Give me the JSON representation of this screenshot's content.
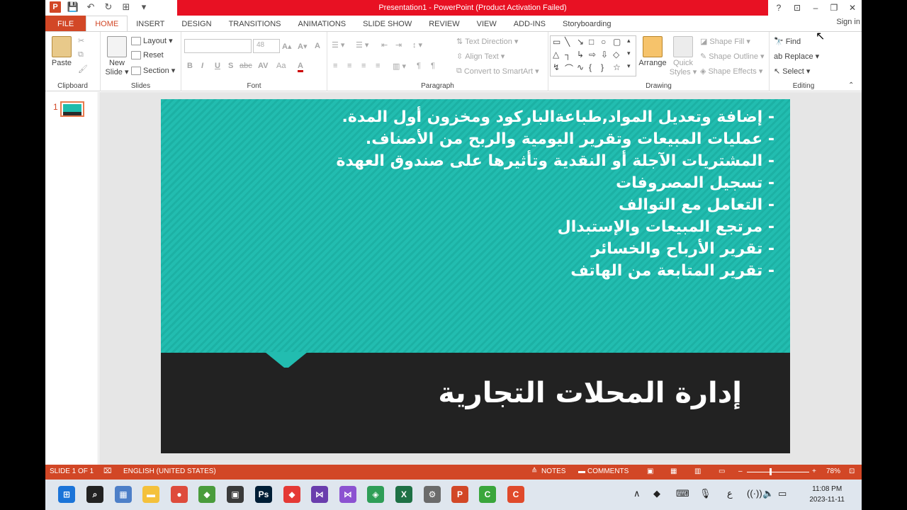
{
  "window": {
    "title": "Presentation1 - PowerPoint (Product Activation Failed)",
    "help": "?",
    "restore_ribbon": "⊡",
    "minimize": "–",
    "maximize": "❐",
    "close": "✕"
  },
  "qat": {
    "logo": "P",
    "save": "💾",
    "undo": "↶",
    "redo": "↻",
    "start": "⊞",
    "more": "▾"
  },
  "tabs": [
    "FILE",
    "HOME",
    "INSERT",
    "DESIGN",
    "TRANSITIONS",
    "ANIMATIONS",
    "SLIDE SHOW",
    "REVIEW",
    "VIEW",
    "ADD-INS",
    "Storyboarding"
  ],
  "sign_in": "Sign in",
  "ribbon": {
    "clipboard": {
      "label": "Clipboard",
      "paste": "Paste"
    },
    "slides": {
      "label": "Slides",
      "new_slide_1": "New",
      "new_slide_2": "Slide ▾",
      "layout": "Layout ▾",
      "reset": "Reset",
      "section": "Section ▾"
    },
    "font": {
      "label": "Font",
      "size": "48",
      "bold": "B",
      "italic": "I",
      "underline": "U",
      "strike": "S",
      "shadow": "abc",
      "spacing": "AV",
      "case": "Aa",
      "color": "A",
      "grow": "A▴",
      "shrink": "A▾",
      "clear": "A"
    },
    "paragraph": {
      "label": "Paragraph",
      "text_direction": "Text Direction ▾",
      "align_text": "Align Text ▾",
      "convert_smartart": "Convert to SmartArt ▾"
    },
    "drawing": {
      "label": "Drawing",
      "arrange": "Arrange",
      "quick_1": "Quick",
      "quick_2": "Styles ▾",
      "shape_fill": "Shape Fill ▾",
      "shape_outline": "Shape Outline ▾",
      "shape_effects": "Shape Effects ▾"
    },
    "editing": {
      "label": "Editing",
      "find": "Find",
      "replace": "Replace ▾",
      "select": "Select ▾"
    }
  },
  "thumbnail": {
    "number": "1"
  },
  "slide": {
    "bullets": [
      "- إضافة وتعديل المواد,طباعةالباركود ومخزون أول المدة.",
      "- عمليات المبيعات وتقرير اليومية والربح من الأصناف.",
      "- المشتريات الآجلة أو النقدية وتأثيرها على صندوق العهدة",
      "- تسجيل المصروفات",
      "- التعامل مع التوالف",
      "- مرتجع المبيعات والإستبدال",
      "- تقرير الأرباح والخسائر",
      "- تقرير المتابعة من الهاتف"
    ],
    "title": "إدارة المحلات التجارية"
  },
  "status": {
    "slide_count": "SLIDE 1 OF 1",
    "language": "ENGLISH (UNITED STATES)",
    "notes": "NOTES",
    "comments": "COMMENTS",
    "zoom_minus": "–",
    "zoom_plus": "+",
    "zoom": "78%"
  },
  "taskbar": {
    "apps": [
      {
        "name": "start",
        "glyph": "⊞",
        "color": "#1b74d8"
      },
      {
        "name": "search",
        "glyph": "⌕",
        "color": "#222222"
      },
      {
        "name": "photos",
        "glyph": "▦",
        "color": "#4d7fc8"
      },
      {
        "name": "explorer",
        "glyph": "▬",
        "color": "#f4c13c"
      },
      {
        "name": "chrome",
        "glyph": "●",
        "color": "#de4b3c"
      },
      {
        "name": "app-green",
        "glyph": "◆",
        "color": "#4a9c3c"
      },
      {
        "name": "app-dark",
        "glyph": "▣",
        "color": "#3a3a3a"
      },
      {
        "name": "photoshop",
        "glyph": "Ps",
        "color": "#001e36"
      },
      {
        "name": "anydesk",
        "glyph": "◆",
        "color": "#e53935"
      },
      {
        "name": "visual-studio-purple",
        "glyph": "⋈",
        "color": "#6a3dad"
      },
      {
        "name": "visual-studio",
        "glyph": "⋈",
        "color": "#8c52d1"
      },
      {
        "name": "app-green2",
        "glyph": "◈",
        "color": "#2f9e57"
      },
      {
        "name": "excel",
        "glyph": "X",
        "color": "#1e7145"
      },
      {
        "name": "settings",
        "glyph": "⚙",
        "color": "#6b6b6b"
      },
      {
        "name": "powerpoint",
        "glyph": "P",
        "color": "#d24726"
      },
      {
        "name": "camtasia-green",
        "glyph": "C",
        "color": "#3aa63c"
      },
      {
        "name": "camtasia-red",
        "glyph": "C",
        "color": "#e04a2b"
      }
    ],
    "tray": {
      "chevron": "∧",
      "lang": "ع",
      "wifi": "((·))",
      "volume": "🔈",
      "battery": "▭",
      "keyboard": "⌨",
      "mic": "🎙",
      "anydesk": "◆"
    },
    "time": "11:08 PM",
    "date": "2023-11-11"
  }
}
